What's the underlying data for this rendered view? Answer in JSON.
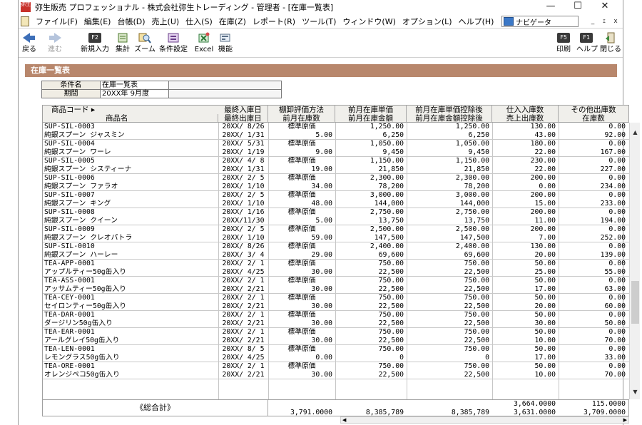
{
  "window": {
    "app_icon_text": "弥生",
    "title": "弥生販売 プロフェッショナル - 株式会社弥生トレーディング - 管理者 - [在庫一覧表]",
    "min": "—",
    "max": "☐",
    "close": "✕"
  },
  "menu": {
    "items": [
      "ファイル(F)",
      "編集(E)",
      "台帳(D)",
      "売上(U)",
      "仕入(S)",
      "在庫(Z)",
      "レポート(R)",
      "ツール(T)",
      "ウィンドウ(W)",
      "オプション(L)",
      "ヘルプ(H)"
    ],
    "navigator": "ナビゲータ",
    "mdi_min": "_",
    "mdi_restore": "ｪ",
    "mdi_close": "x"
  },
  "toolbar": {
    "back": "戻る",
    "forward": "進む",
    "new_key": "F2",
    "new": "新規入力",
    "sum": "集計",
    "zoom": "ズーム",
    "condition": "条件設定",
    "excel": "Excel",
    "function": "機能",
    "print_key": "F5",
    "print": "印刷",
    "help_key": "F1",
    "help": "ヘルプ",
    "close": "閉じる"
  },
  "section_title": "在庫一覧表",
  "conditions": {
    "name_label": "条件名",
    "name_value": "在庫一覧表",
    "period_label": "期間",
    "period_value": "20XX年 9月度"
  },
  "columns": {
    "code": "商品コード ▸",
    "name": "商品名",
    "last_in": "最終入庫日",
    "last_out": "最終出庫日",
    "method": "棚卸評価方法",
    "prev_qty": "前月在庫数",
    "prev_price": "前月在庫単価",
    "prev_amount": "前月在庫金額",
    "adj_price": "前月在庫単価控除後",
    "adj_amount": "前月在庫金額控除後",
    "in_qty": "仕入入庫数",
    "out_qty": "売上出庫数",
    "other_out": "その他出庫数",
    "stock": "在庫数"
  },
  "rows": [
    {
      "code": "SUP-SIL-0003",
      "name": "純銀スプーン ジャスミン",
      "in_date": "20XX/ 8/26",
      "out_date": "20XX/ 1/31",
      "method": "標準原価",
      "prev_qty": "5.00",
      "price": "1,250.00",
      "amount": "6,250",
      "adj_price": "1,250.00",
      "adj_amount": "6,250",
      "in_qty": "130.00",
      "out_qty": "43.00",
      "other": "0.00",
      "stock": "92.00"
    },
    {
      "code": "SUP-SIL-0004",
      "name": "純銀スプーン ワーレ",
      "in_date": "20XX/ 5/31",
      "out_date": "20XX/ 1/19",
      "method": "標準原価",
      "prev_qty": "9.00",
      "price": "1,050.00",
      "amount": "9,450",
      "adj_price": "1,050.00",
      "adj_amount": "9,450",
      "in_qty": "180.00",
      "out_qty": "22.00",
      "other": "0.00",
      "stock": "167.00"
    },
    {
      "code": "SUP-SIL-0005",
      "name": "純銀スプーン システィーナ",
      "in_date": "20XX/ 4/ 8",
      "out_date": "20XX/ 1/31",
      "method": "標準原価",
      "prev_qty": "19.00",
      "price": "1,150.00",
      "amount": "21,850",
      "adj_price": "1,150.00",
      "adj_amount": "21,850",
      "in_qty": "230.00",
      "out_qty": "22.00",
      "other": "0.00",
      "stock": "227.00"
    },
    {
      "code": "SUP-SIL-0006",
      "name": "純銀スプーン ファラオ",
      "in_date": "20XX/ 2/ 5",
      "out_date": "20XX/ 1/10",
      "method": "標準原価",
      "prev_qty": "34.00",
      "price": "2,300.00",
      "amount": "78,200",
      "adj_price": "2,300.00",
      "adj_amount": "78,200",
      "in_qty": "200.00",
      "out_qty": "0.00",
      "other": "0.00",
      "stock": "234.00"
    },
    {
      "code": "SUP-SIL-0007",
      "name": "純銀スプーン キング",
      "in_date": "20XX/ 2/ 5",
      "out_date": "20XX/ 1/10",
      "method": "標準原価",
      "prev_qty": "48.00",
      "price": "3,000.00",
      "amount": "144,000",
      "adj_price": "3,000.00",
      "adj_amount": "144,000",
      "in_qty": "200.00",
      "out_qty": "15.00",
      "other": "0.00",
      "stock": "233.00"
    },
    {
      "code": "SUP-SIL-0008",
      "name": "純銀スプーン クイーン",
      "in_date": "20XX/ 1/16",
      "out_date": "20XX/11/30",
      "method": "標準原価",
      "prev_qty": "5.00",
      "price": "2,750.00",
      "amount": "13,750",
      "adj_price": "2,750.00",
      "adj_amount": "13,750",
      "in_qty": "200.00",
      "out_qty": "11.00",
      "other": "0.00",
      "stock": "194.00"
    },
    {
      "code": "SUP-SIL-0009",
      "name": "純銀スプーン クレオパトラ",
      "in_date": "20XX/ 2/ 5",
      "out_date": "20XX/ 1/10",
      "method": "標準原価",
      "prev_qty": "59.00",
      "price": "2,500.00",
      "amount": "147,500",
      "adj_price": "2,500.00",
      "adj_amount": "147,500",
      "in_qty": "200.00",
      "out_qty": "7.00",
      "other": "0.00",
      "stock": "252.00"
    },
    {
      "code": "SUP-SIL-0010",
      "name": "純銀スプーン ハーレー",
      "in_date": "20XX/ 8/26",
      "out_date": "20XX/ 3/ 4",
      "method": "標準原価",
      "prev_qty": "29.00",
      "price": "2,400.00",
      "amount": "69,600",
      "adj_price": "2,400.00",
      "adj_amount": "69,600",
      "in_qty": "130.00",
      "out_qty": "20.00",
      "other": "0.00",
      "stock": "139.00"
    },
    {
      "code": "TEA-APP-0001",
      "name": "アップルティー50g缶入り",
      "in_date": "20XX/ 2/ 1",
      "out_date": "20XX/ 4/25",
      "method": "標準原価",
      "prev_qty": "30.00",
      "price": "750.00",
      "amount": "22,500",
      "adj_price": "750.00",
      "adj_amount": "22,500",
      "in_qty": "50.00",
      "out_qty": "25.00",
      "other": "0.00",
      "stock": "55.00"
    },
    {
      "code": "TEA-ASS-0001",
      "name": "アッサムティー50g缶入り",
      "in_date": "20XX/ 2/ 1",
      "out_date": "20XX/ 2/21",
      "method": "標準原価",
      "prev_qty": "30.00",
      "price": "750.00",
      "amount": "22,500",
      "adj_price": "750.00",
      "adj_amount": "22,500",
      "in_qty": "50.00",
      "out_qty": "17.00",
      "other": "0.00",
      "stock": "63.00"
    },
    {
      "code": "TEA-CEY-0001",
      "name": "セイロンティー50g缶入り",
      "in_date": "20XX/ 2/ 1",
      "out_date": "20XX/ 2/21",
      "method": "標準原価",
      "prev_qty": "30.00",
      "price": "750.00",
      "amount": "22,500",
      "adj_price": "750.00",
      "adj_amount": "22,500",
      "in_qty": "50.00",
      "out_qty": "20.00",
      "other": "0.00",
      "stock": "60.00"
    },
    {
      "code": "TEA-DAR-0001",
      "name": "ダージリン50g缶入り",
      "in_date": "20XX/ 2/ 1",
      "out_date": "20XX/ 2/21",
      "method": "標準原価",
      "prev_qty": "30.00",
      "price": "750.00",
      "amount": "22,500",
      "adj_price": "750.00",
      "adj_amount": "22,500",
      "in_qty": "50.00",
      "out_qty": "30.00",
      "other": "0.00",
      "stock": "50.00"
    },
    {
      "code": "TEA-EAR-0001",
      "name": "アールグレイ50g缶入り",
      "in_date": "20XX/ 2/ 1",
      "out_date": "20XX/ 2/21",
      "method": "標準原価",
      "prev_qty": "30.00",
      "price": "750.00",
      "amount": "22,500",
      "adj_price": "750.00",
      "adj_amount": "22,500",
      "in_qty": "50.00",
      "out_qty": "10.00",
      "other": "0.00",
      "stock": "70.00"
    },
    {
      "code": "TEA-LEN-0001",
      "name": "レモングラス50g缶入り",
      "in_date": "20XX/ 8/ 5",
      "out_date": "20XX/ 4/25",
      "method": "標準原価",
      "prev_qty": "0.00",
      "price": "750.00",
      "amount": "0",
      "adj_price": "750.00",
      "adj_amount": "0",
      "in_qty": "50.00",
      "out_qty": "17.00",
      "other": "0.00",
      "stock": "33.00"
    },
    {
      "code": "TEA-ORE-0001",
      "name": "オレンジペコ50g缶入り",
      "in_date": "20XX/ 2/ 1",
      "out_date": "20XX/ 2/21",
      "method": "標準原価",
      "prev_qty": "30.00",
      "price": "750.00",
      "amount": "22,500",
      "adj_price": "750.00",
      "adj_amount": "22,500",
      "in_qty": "50.00",
      "out_qty": "10.00",
      "other": "0.00",
      "stock": "70.00"
    }
  ],
  "totals": {
    "label": "《総合計》",
    "prev_qty": "3,791.0000",
    "amount": "8,385,789",
    "adj_amount": "8,385,789",
    "in_qty": "3,664.0000",
    "out_qty": "3,631.0000",
    "other": "115.0000",
    "stock": "3,709.0000"
  },
  "scroll": {
    "up": "▲",
    "down": "▼",
    "left": "◀",
    "right": "▶"
  },
  "colors": {
    "section_bar": "#b8876c",
    "header_bg": "#f0efeb",
    "app_icon": "#c8312a"
  }
}
